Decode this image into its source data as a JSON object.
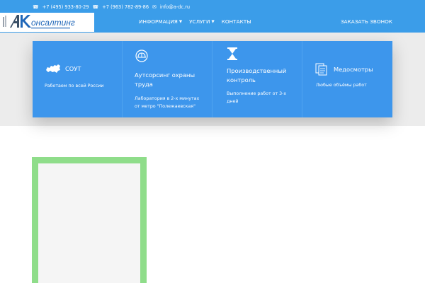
{
  "header": {
    "phone1": "+7 (495) 933-80-29",
    "phone2": "+7 (963) 782-89-86",
    "email": "info@a-dc.ru",
    "logo_text": "онсалтинг",
    "logo_icon": "ak-logo-icon",
    "nav": [
      {
        "label": "ИНФОРМАЦИЯ",
        "has_dropdown": true
      },
      {
        "label": "УСЛУГИ",
        "has_dropdown": true
      },
      {
        "label": "КОНТАКТЫ",
        "has_dropdown": false
      }
    ],
    "callback_label": "ЗАКАЗАТЬ ЗВОНОК"
  },
  "features": [
    {
      "icon": "russia-map-icon",
      "title": "СОУТ",
      "desc": "Работаем по всей России"
    },
    {
      "icon": "helmet-icon",
      "title": "Аутсорсинг охраны труда",
      "title_lines": [
        "Аутсорсинг охраны",
        "труда"
      ],
      "desc": "Лаборатория в 2-х минутах от метро \"Полежаевская\"",
      "desc_lines": [
        "Лаборатория в 2-х минутах",
        "от метро \"Полежаевская\""
      ]
    },
    {
      "icon": "hourglass-icon",
      "title": "Производственный контроль",
      "title_lines": [
        "Производственный",
        "контроль"
      ],
      "desc": "Выполнение работ от 3-х дней",
      "desc_lines": [
        "Выполнение работ от 3-х",
        "дней"
      ]
    },
    {
      "icon": "documents-icon",
      "title": "Медосмотры",
      "desc": "Любые объёмы работ"
    }
  ],
  "colors": {
    "topbar": "#3b9de9",
    "features_bg": "#3d96ec",
    "band": "#ececec",
    "frame": "#8fdd8a"
  }
}
